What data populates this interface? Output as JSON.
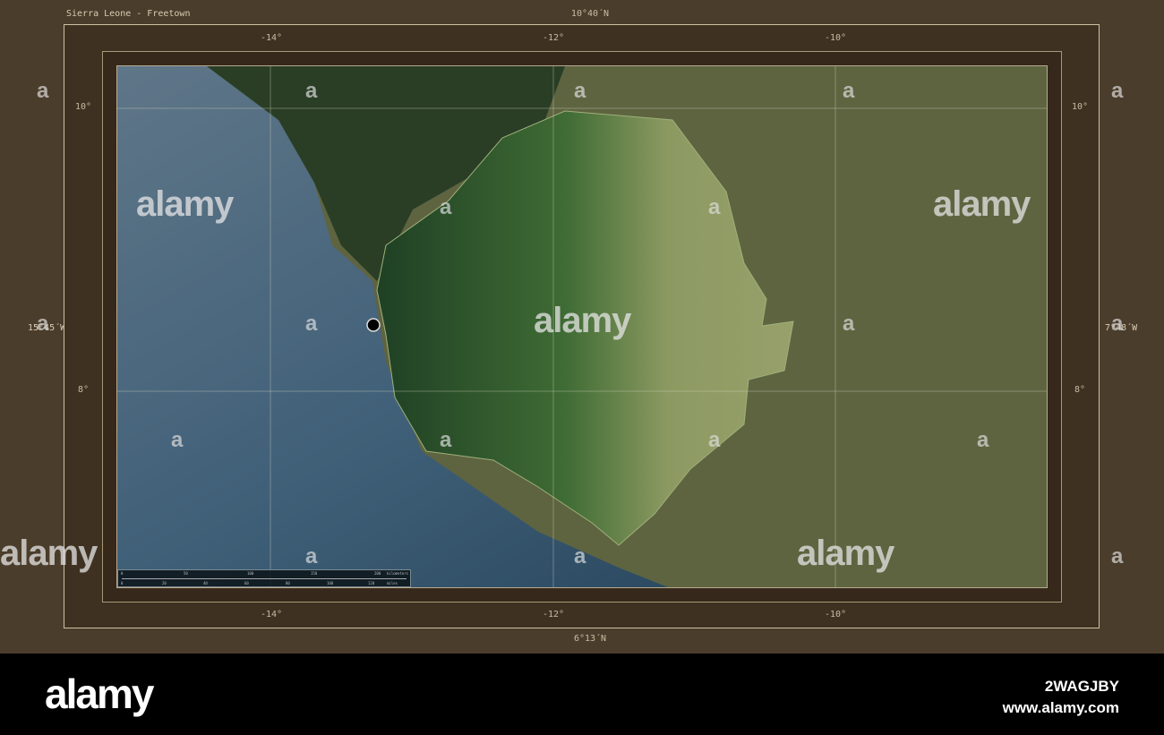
{
  "title": "Sierra Leone - Freetown",
  "bounds": {
    "north": "10°40´N",
    "south": "6°13´N",
    "west": "15°45´W",
    "east": "7°48´W"
  },
  "longitude_ticks": [
    "-14°",
    "-12°",
    "-10°"
  ],
  "latitude_ticks": [
    "10°",
    "8°"
  ],
  "marker": {
    "label": "Freetown"
  },
  "scale_bar": {
    "km_label": "kilometers",
    "km_ticks": [
      "0",
      "50",
      "100",
      "150",
      "200"
    ],
    "mi_label": "miles",
    "mi_ticks": [
      "0",
      "20",
      "40",
      "60",
      "80",
      "100",
      "120"
    ]
  },
  "watermark": {
    "text": "alamy",
    "letter": "a"
  },
  "footer": {
    "brand": "alamy",
    "image_id": "2WAGJBY",
    "url": "www.alamy.com"
  },
  "colors": {
    "ocean": "#4d6a7e",
    "land_outside": "#6b6a45",
    "country": "#4f7a3c",
    "frame": "#4b3d2b"
  }
}
